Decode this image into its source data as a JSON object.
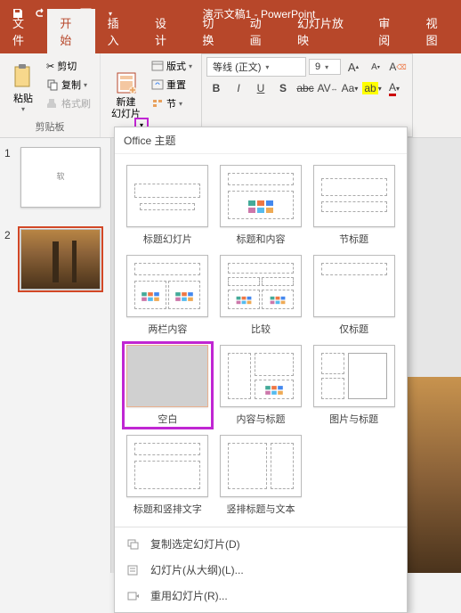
{
  "titlebar": {
    "title": "演示文稿1 - PowerPoint"
  },
  "tabs": {
    "file": "文件",
    "home": "开始",
    "insert": "插入",
    "design": "设计",
    "transitions": "切换",
    "animations": "动画",
    "slideshow": "幻灯片放映",
    "review": "审阅",
    "view": "视图"
  },
  "ribbon": {
    "paste": "粘贴",
    "cut": "剪切",
    "copy": "复制",
    "format_painter": "格式刷",
    "clipboard_group": "剪贴板",
    "new_slide": "新建\n幻灯片",
    "layout": "版式",
    "reset": "重置",
    "section": "节",
    "font_name": "等线 (正文)",
    "font_size": "9"
  },
  "slides": {
    "s1_num": "1",
    "s2_num": "2",
    "s1_placeholder": "软"
  },
  "dropdown": {
    "header": "Office 主题",
    "layouts": {
      "title_slide": "标题幻灯片",
      "title_content": "标题和内容",
      "section_header": "节标题",
      "two_content": "两栏内容",
      "comparison": "比较",
      "title_only": "仅标题",
      "blank": "空白",
      "content_caption": "内容与标题",
      "picture_caption": "图片与标题",
      "title_vertical": "标题和竖排文字",
      "vertical_title": "竖排标题与文本"
    },
    "footer": {
      "duplicate": "复制选定幻灯片(D)",
      "from_outline": "幻灯片(从大纲)(L)...",
      "reuse": "重用幻灯片(R)..."
    }
  }
}
